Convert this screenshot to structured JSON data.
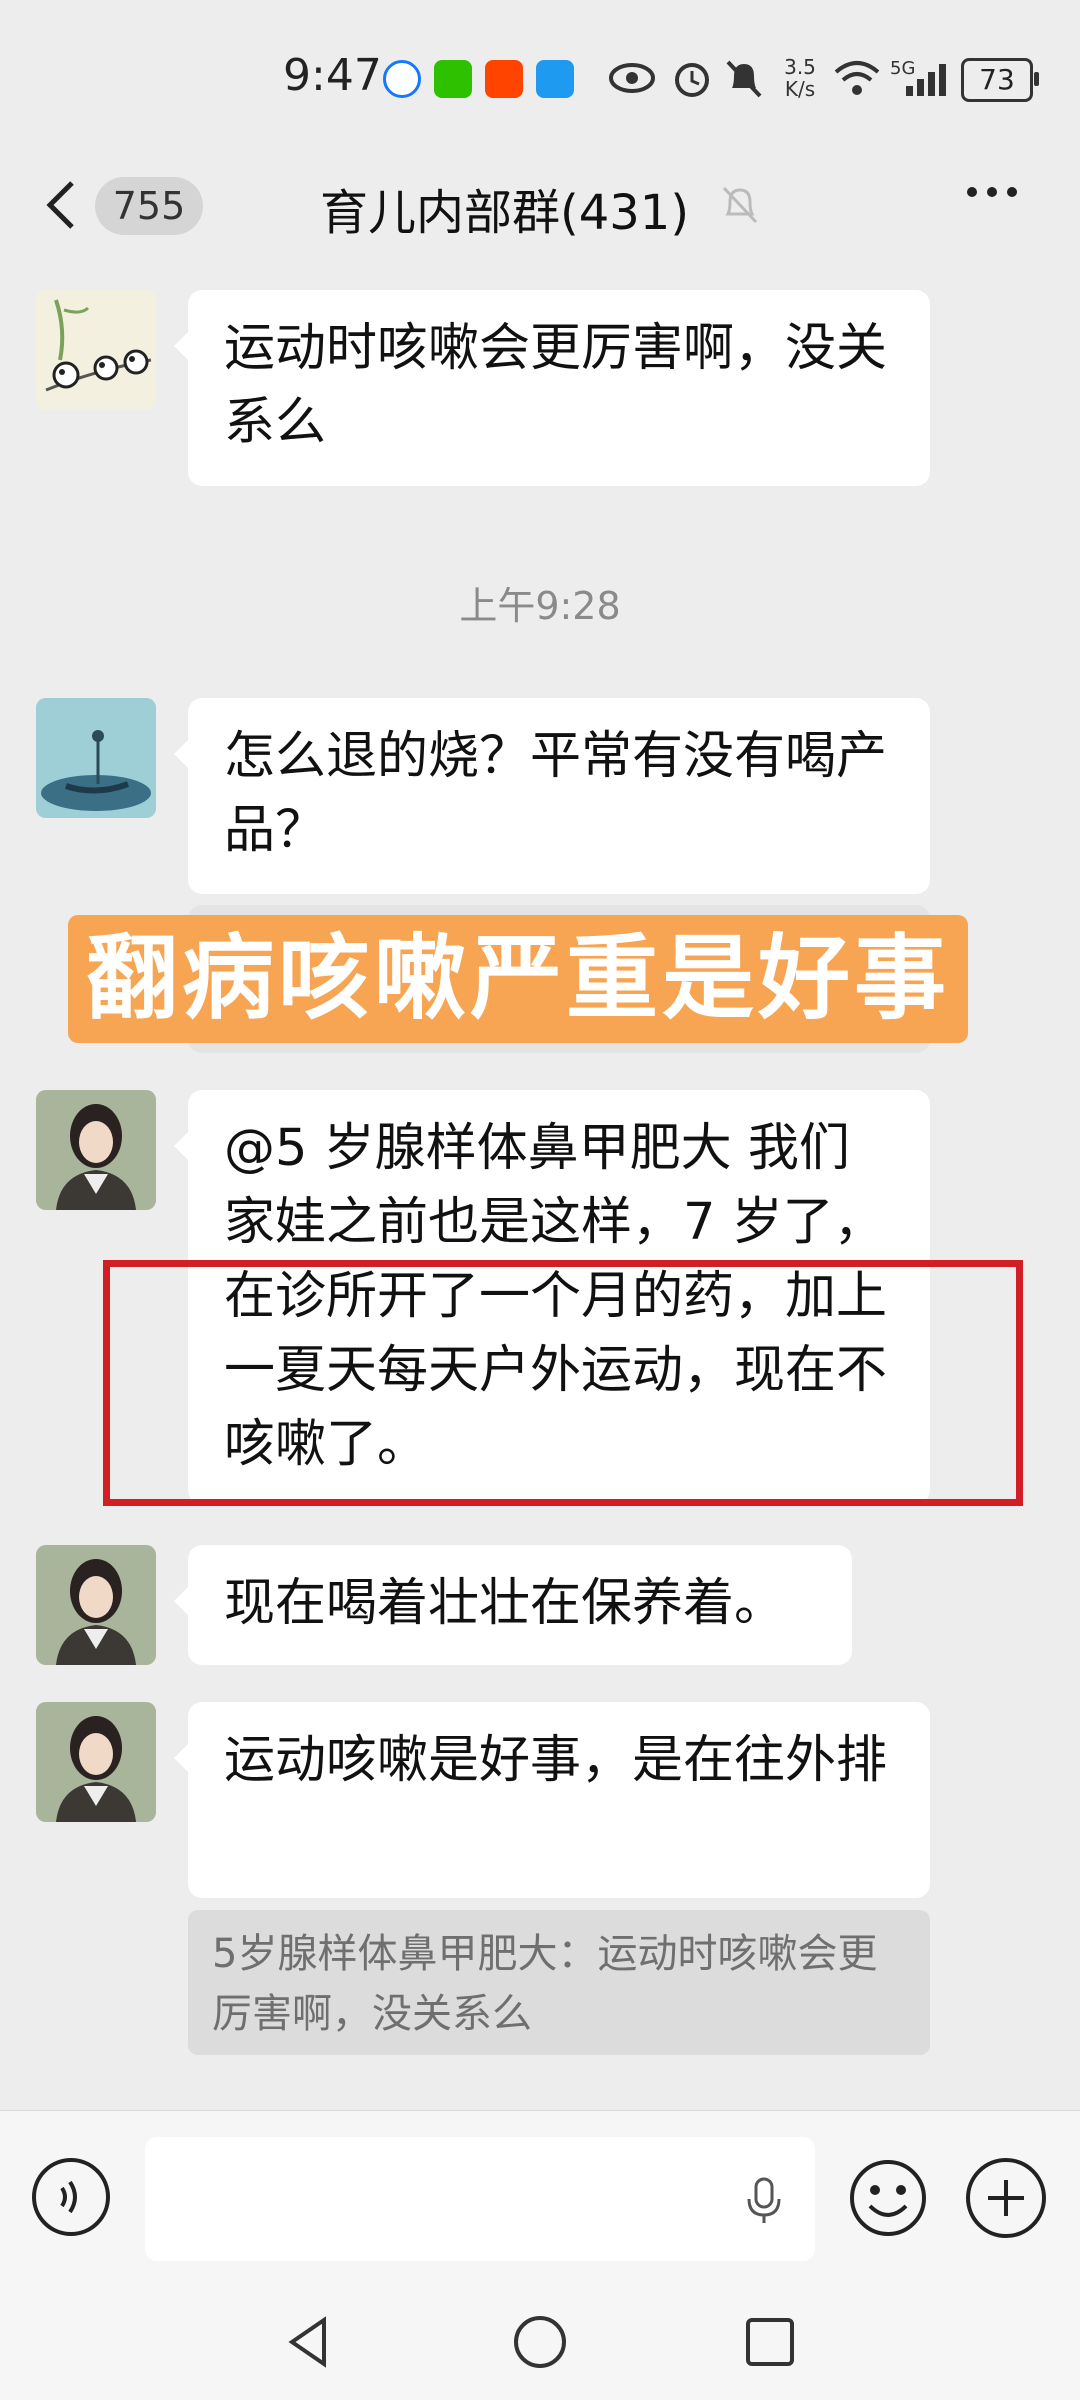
{
  "status_bar": {
    "time": "9:47",
    "net_speed_top": "3.5",
    "net_speed_bottom": "K/s",
    "signal": "5G",
    "battery": "73"
  },
  "header": {
    "unread_count": "755",
    "title": "育儿内部群(431)"
  },
  "messages": [
    {
      "text": "运动时咳嗽会更厉害啊，没关系么"
    },
    {
      "text": "怎么退的烧？平常有没有喝产品？"
    },
    {
      "text": "@5 岁腺样体鼻甲肥大  我们家娃之前也是这样，7 岁了，在诊所开了一个月的药，加上一夏天每天户外运动，现在不咳嗽了。"
    },
    {
      "text": "现在喝着壮壮在保养着。"
    },
    {
      "text": "运动咳嗽是好事，是在往外排"
    }
  ],
  "timestamp": "上午9:28",
  "quote": {
    "text": "5岁腺样体鼻甲肥大：运动时咳嗽会更厉害啊，没关系么"
  },
  "overlay_banner": "翻病咳嗽严重是好事",
  "colors": {
    "background": "#ededed",
    "banner": "#f7a552",
    "highlight_border": "#d21f26"
  },
  "icons": {
    "back": "chevron-left-icon",
    "mute": "bell-off-icon",
    "more": "more-icon",
    "voice": "voice-icon",
    "mic": "microphone-icon",
    "emoji": "emoji-icon",
    "add": "plus-icon"
  }
}
